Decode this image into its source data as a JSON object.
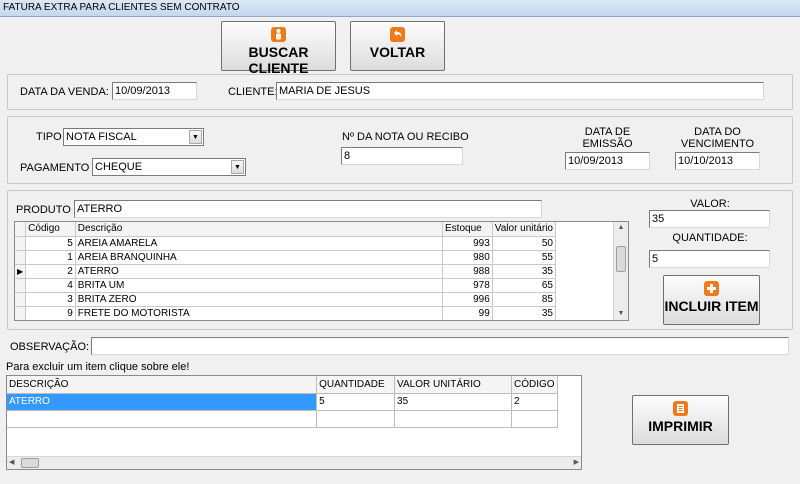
{
  "window": {
    "title": "FATURA EXTRA PARA CLIENTES SEM CONTRATO"
  },
  "toolbar": {
    "buscar_label": "BUSCAR CLIENTE",
    "voltar_label": "VOLTAR"
  },
  "header": {
    "data_venda_label": "DATA DA VENDA:",
    "data_venda_value": "10/09/2013",
    "cliente_label": "CLIENTE:",
    "cliente_value": "MARIA DE JESUS"
  },
  "doc": {
    "tipo_label": "TIPO",
    "tipo_value": "NOTA FISCAL",
    "pagamento_label": "PAGAMENTO",
    "pagamento_value": "CHEQUE",
    "nota_label": "Nº DA NOTA OU RECIBO",
    "nota_value": "8",
    "emissao_label_1": "DATA DE",
    "emissao_label_2": "EMISSÃO",
    "emissao_value": "10/09/2013",
    "vencimento_label_1": "DATA DO",
    "vencimento_label_2": "VENCIMENTO",
    "vencimento_value": "10/10/2013"
  },
  "produto": {
    "label": "PRODUTO",
    "value": "ATERRO",
    "columns": [
      "Código",
      "Descrição",
      "Estoque",
      "Valor unitário"
    ],
    "rows": [
      {
        "codigo": "5",
        "descricao": "AREIA AMARELA",
        "estoque": "993",
        "valor": "50"
      },
      {
        "codigo": "1",
        "descricao": "AREIA BRANQUINHA",
        "estoque": "980",
        "valor": "55"
      },
      {
        "codigo": "2",
        "descricao": "ATERRO",
        "estoque": "988",
        "valor": "35"
      },
      {
        "codigo": "4",
        "descricao": "BRITA UM",
        "estoque": "978",
        "valor": "65"
      },
      {
        "codigo": "3",
        "descricao": "BRITA ZERO",
        "estoque": "996",
        "valor": "85"
      },
      {
        "codigo": "9",
        "descricao": "FRETE DO MOTORISTA",
        "estoque": "99",
        "valor": "35"
      }
    ],
    "current_row_marker": "▶",
    "valor_label": "VALOR:",
    "valor_value": "35",
    "quantidade_label": "QUANTIDADE:",
    "quantidade_value": "5",
    "incluir_label": "INCLUIR ITEM"
  },
  "observacao": {
    "label": "OBSERVAÇÃO:",
    "value": ""
  },
  "itens": {
    "hint": "Para excluir um item clique sobre ele!",
    "columns": [
      "DESCRIÇÃO",
      "QUANTIDADE",
      "VALOR UNITÁRIO",
      "CÓDIGO"
    ],
    "rows": [
      {
        "descricao": "ATERRO",
        "quantidade": "5",
        "valor": "35",
        "codigo": "2"
      }
    ]
  },
  "imprimir_label": "IMPRIMIR",
  "colors": {
    "accent_orange": "#f07a1a",
    "selection_blue": "#3399ff"
  },
  "icons": {
    "buscar": "person-icon",
    "voltar": "undo-arrow-icon",
    "incluir": "plus-icon",
    "imprimir": "document-icon"
  }
}
